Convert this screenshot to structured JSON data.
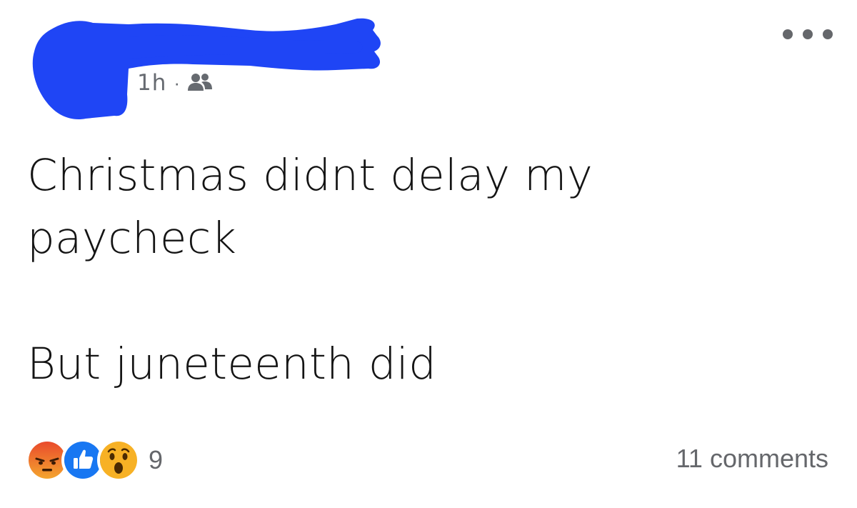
{
  "header": {
    "time": "1h",
    "separator": "·",
    "audience_icon": "friends-icon",
    "menu_icon": "more-options-icon"
  },
  "post": {
    "line1": "Christmas didnt delay my",
    "line2": "paycheck",
    "line3": "But juneteenth did"
  },
  "footer": {
    "reaction_icons": [
      "angry-reaction-icon",
      "like-reaction-icon",
      "wow-reaction-icon"
    ],
    "reaction_count": "9",
    "comments": "11 comments"
  },
  "colors": {
    "redaction": "#1f45f5",
    "meta_text": "#666a70",
    "angry": "#e9710f",
    "like": "#1877f2",
    "wow": "#f7b125"
  }
}
